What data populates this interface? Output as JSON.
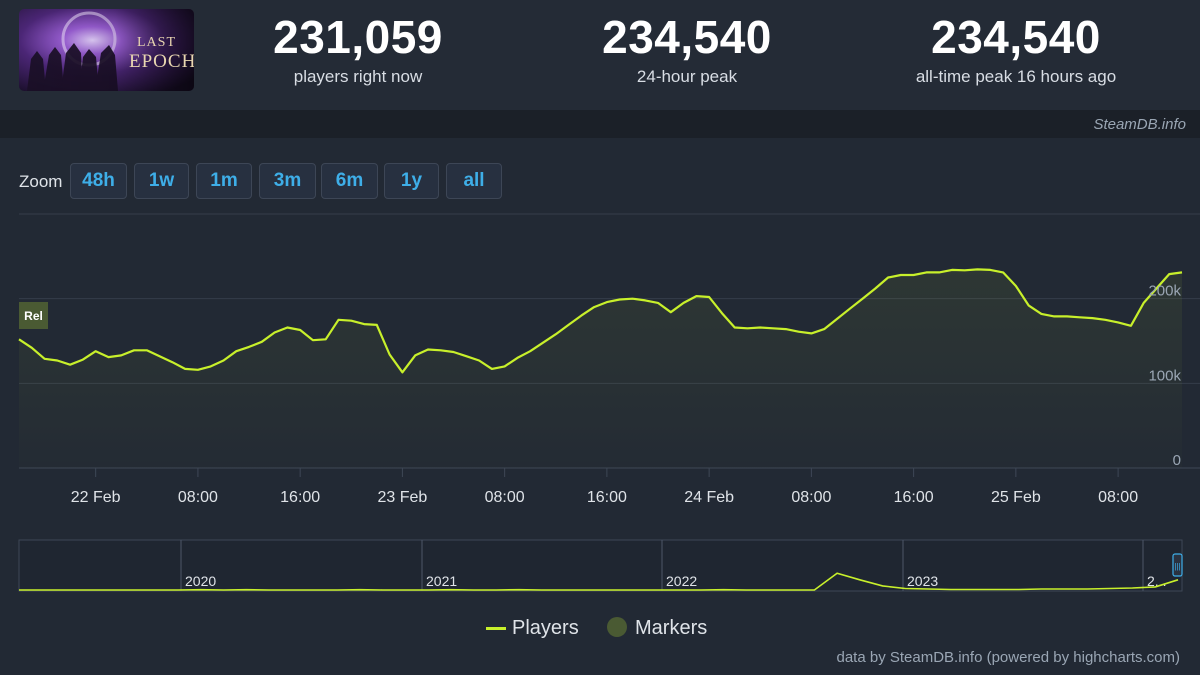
{
  "game": {
    "logo_text_line1": "LAST",
    "logo_text_line2": "EPOCH"
  },
  "stats": [
    {
      "value": "231,059",
      "label": "players right now"
    },
    {
      "value": "234,540",
      "label": "24-hour peak"
    },
    {
      "value": "234,540",
      "label": "all-time peak 16 hours ago"
    }
  ],
  "credit_top": "SteamDB.info",
  "zoom": {
    "label": "Zoom",
    "buttons": [
      "48h",
      "1w",
      "1m",
      "3m",
      "6m",
      "1y",
      "all"
    ]
  },
  "chart_data": {
    "type": "line",
    "x_unit": "hours since 21 Feb 18:00",
    "x_ticks": [
      "22 Feb",
      "08:00",
      "16:00",
      "23 Feb",
      "08:00",
      "16:00",
      "24 Feb",
      "08:00",
      "16:00",
      "25 Feb",
      "08:00"
    ],
    "y_ticks": [
      "0",
      "100k",
      "200k"
    ],
    "ylim": [
      0,
      300000
    ],
    "marker_label": "Rel",
    "series": [
      {
        "name": "Players",
        "color": "#c8f02b",
        "points": [
          [
            0,
            152000
          ],
          [
            1,
            142000
          ],
          [
            2,
            129000
          ],
          [
            3,
            127000
          ],
          [
            4,
            122000
          ],
          [
            5,
            128000
          ],
          [
            6,
            138000
          ],
          [
            7,
            131000
          ],
          [
            8,
            133000
          ],
          [
            9,
            139000
          ],
          [
            10,
            139000
          ],
          [
            11,
            132000
          ],
          [
            12,
            125000
          ],
          [
            13,
            117000
          ],
          [
            14,
            116000
          ],
          [
            15,
            120000
          ],
          [
            16,
            127000
          ],
          [
            17,
            138000
          ],
          [
            18,
            143000
          ],
          [
            19,
            149000
          ],
          [
            20,
            160000
          ],
          [
            21,
            166000
          ],
          [
            22,
            163000
          ],
          [
            23,
            151000
          ],
          [
            24,
            152000
          ],
          [
            25,
            175000
          ],
          [
            26,
            174000
          ],
          [
            27,
            170000
          ],
          [
            28,
            169000
          ],
          [
            29,
            134000
          ],
          [
            30,
            113000
          ],
          [
            31,
            133000
          ],
          [
            32,
            140000
          ],
          [
            33,
            139000
          ],
          [
            34,
            137000
          ],
          [
            35,
            132000
          ],
          [
            36,
            127000
          ],
          [
            37,
            117000
          ],
          [
            38,
            120000
          ],
          [
            39,
            130000
          ],
          [
            40,
            138000
          ],
          [
            41,
            148000
          ],
          [
            42,
            158000
          ],
          [
            43,
            169000
          ],
          [
            44,
            180000
          ],
          [
            45,
            190000
          ],
          [
            46,
            196000
          ],
          [
            47,
            199000
          ],
          [
            48,
            200000
          ],
          [
            49,
            198000
          ],
          [
            50,
            195000
          ],
          [
            51,
            184000
          ],
          [
            52,
            195000
          ],
          [
            53,
            203000
          ],
          [
            54,
            202000
          ],
          [
            55,
            183000
          ],
          [
            56,
            166000
          ],
          [
            57,
            165000
          ],
          [
            58,
            166000
          ],
          [
            59,
            165000
          ],
          [
            60,
            164000
          ],
          [
            61,
            161000
          ],
          [
            62,
            159000
          ],
          [
            63,
            164000
          ],
          [
            64,
            176000
          ],
          [
            65,
            188000
          ],
          [
            66,
            200000
          ],
          [
            67,
            212000
          ],
          [
            68,
            225000
          ],
          [
            69,
            228000
          ],
          [
            70,
            228000
          ],
          [
            71,
            231000
          ],
          [
            72,
            231000
          ],
          [
            73,
            234000
          ],
          [
            74,
            233540
          ],
          [
            75,
            234540
          ],
          [
            76,
            234000
          ],
          [
            77,
            231000
          ],
          [
            78,
            215000
          ],
          [
            79,
            192000
          ],
          [
            80,
            182000
          ],
          [
            81,
            179000
          ],
          [
            82,
            179000
          ],
          [
            83,
            178000
          ],
          [
            84,
            177000
          ],
          [
            85,
            175000
          ],
          [
            86,
            172000
          ],
          [
            87,
            168000
          ],
          [
            88,
            195000
          ],
          [
            89,
            212000
          ],
          [
            90,
            229000
          ],
          [
            91,
            231059
          ]
        ]
      }
    ],
    "navigator": {
      "year_labels": [
        "2020",
        "2021",
        "2022",
        "2023",
        "2..."
      ],
      "handle_glyph": "|||",
      "values": [
        0,
        0,
        0,
        0,
        0,
        0,
        0,
        0,
        0.005,
        0,
        0.005,
        0,
        0,
        0,
        0,
        0.005,
        0,
        0,
        0,
        0.005,
        0,
        0,
        0.005,
        0,
        0,
        0,
        0,
        0,
        0,
        0,
        0,
        0.005,
        0,
        0,
        0,
        0,
        0.33,
        0.2,
        0.08,
        0.03,
        0.02,
        0.01,
        0.01,
        0.01,
        0.01,
        0.02,
        0.02,
        0.02,
        0.03,
        0.04,
        0.06,
        0.2
      ]
    },
    "legend": [
      {
        "name": "Players",
        "kind": "line",
        "color": "#c8f02b"
      },
      {
        "name": "Markers",
        "kind": "dot",
        "color": "#4a5a33"
      }
    ]
  },
  "credit_bottom": "data by SteamDB.info (powered by highcharts.com)"
}
